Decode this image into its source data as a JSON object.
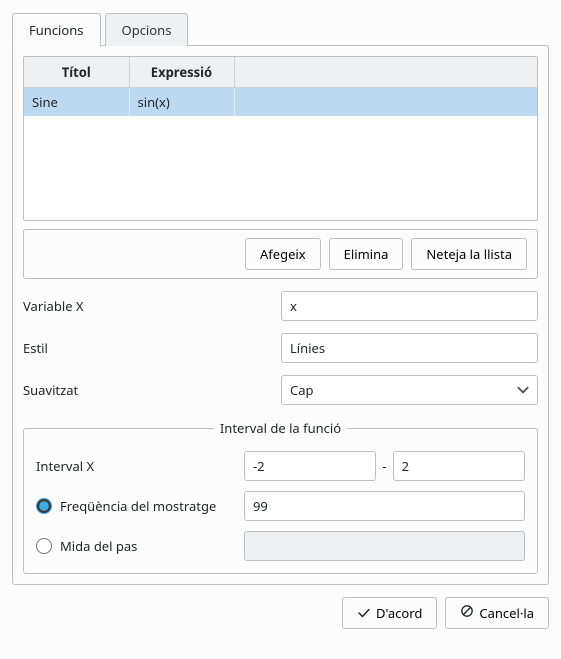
{
  "tabs": {
    "funcions": "Funcions",
    "opcions": "Opcions"
  },
  "table": {
    "headers": {
      "title": "Títol",
      "expr": "Expressió"
    },
    "rows": [
      {
        "title": "Sine",
        "expr": "sin(x)"
      }
    ]
  },
  "buttons": {
    "add": "Afegeix",
    "remove": "Elimina",
    "clear": "Neteja la llista"
  },
  "fields": {
    "varx_label": "Variable X",
    "varx_value": "x",
    "style_label": "Estil",
    "style_value": "Línies",
    "smooth_label": "Suavitzat",
    "smooth_value": "Cap"
  },
  "interval": {
    "legend": "Interval de la funció",
    "x_label": "Interval X",
    "x_from": "-2",
    "x_to": "2",
    "freq_label": "Freqüència del mostratge",
    "freq_value": "99",
    "step_label": "Mida del pas",
    "step_value": ""
  },
  "dialog": {
    "ok": "D'acord",
    "cancel": "Cancel·la"
  }
}
